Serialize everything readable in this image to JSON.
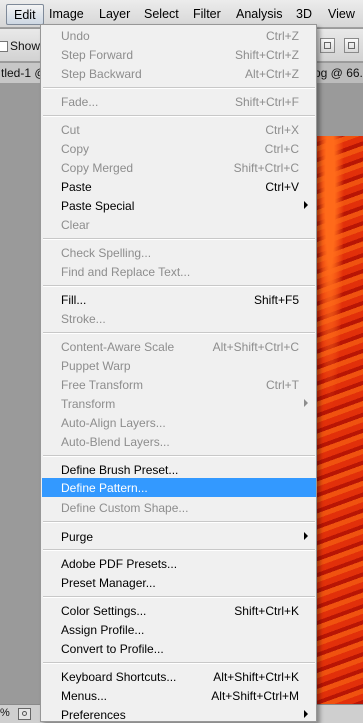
{
  "menubar": {
    "items": [
      "Edit",
      "Image",
      "Layer",
      "Select",
      "Filter",
      "Analysis",
      "3D",
      "View"
    ]
  },
  "options_bar": {
    "show_label": "Show E"
  },
  "tabs": {
    "left": "tled-1 @",
    "right": "pg @ 66."
  },
  "statusbar": {
    "zoom": "%"
  },
  "edit_menu": {
    "items": [
      {
        "label": "Undo",
        "shortcut": "Ctrl+Z",
        "enabled": false
      },
      {
        "label": "Step Forward",
        "shortcut": "Shift+Ctrl+Z",
        "enabled": false
      },
      {
        "label": "Step Backward",
        "shortcut": "Alt+Ctrl+Z",
        "enabled": false
      },
      {
        "label": "Fade...",
        "shortcut": "Shift+Ctrl+F",
        "enabled": false
      },
      {
        "label": "Cut",
        "shortcut": "Ctrl+X",
        "enabled": false
      },
      {
        "label": "Copy",
        "shortcut": "Ctrl+C",
        "enabled": false
      },
      {
        "label": "Copy Merged",
        "shortcut": "Shift+Ctrl+C",
        "enabled": false
      },
      {
        "label": "Paste",
        "shortcut": "Ctrl+V",
        "enabled": true
      },
      {
        "label": "Paste Special",
        "shortcut": "",
        "enabled": true,
        "submenu": true
      },
      {
        "label": "Clear",
        "shortcut": "",
        "enabled": false
      },
      {
        "label": "Check Spelling...",
        "shortcut": "",
        "enabled": false
      },
      {
        "label": "Find and Replace Text...",
        "shortcut": "",
        "enabled": false
      },
      {
        "label": "Fill...",
        "shortcut": "Shift+F5",
        "enabled": true
      },
      {
        "label": "Stroke...",
        "shortcut": "",
        "enabled": false
      },
      {
        "label": "Content-Aware Scale",
        "shortcut": "Alt+Shift+Ctrl+C",
        "enabled": false
      },
      {
        "label": "Puppet Warp",
        "shortcut": "",
        "enabled": false
      },
      {
        "label": "Free Transform",
        "shortcut": "Ctrl+T",
        "enabled": false
      },
      {
        "label": "Transform",
        "shortcut": "",
        "enabled": false,
        "submenu": true
      },
      {
        "label": "Auto-Align Layers...",
        "shortcut": "",
        "enabled": false
      },
      {
        "label": "Auto-Blend Layers...",
        "shortcut": "",
        "enabled": false
      },
      {
        "label": "Define Brush Preset...",
        "shortcut": "",
        "enabled": true
      },
      {
        "label": "Define Pattern...",
        "shortcut": "",
        "enabled": true,
        "highlighted": true
      },
      {
        "label": "Define Custom Shape...",
        "shortcut": "",
        "enabled": false
      },
      {
        "label": "Purge",
        "shortcut": "",
        "enabled": true,
        "submenu": true
      },
      {
        "label": "Adobe PDF Presets...",
        "shortcut": "",
        "enabled": true
      },
      {
        "label": "Preset Manager...",
        "shortcut": "",
        "enabled": true
      },
      {
        "label": "Color Settings...",
        "shortcut": "Shift+Ctrl+K",
        "enabled": true
      },
      {
        "label": "Assign Profile...",
        "shortcut": "",
        "enabled": true
      },
      {
        "label": "Convert to Profile...",
        "shortcut": "",
        "enabled": true
      },
      {
        "label": "Keyboard Shortcuts...",
        "shortcut": "Alt+Shift+Ctrl+K",
        "enabled": true
      },
      {
        "label": "Menus...",
        "shortcut": "Alt+Shift+Ctrl+M",
        "enabled": true
      },
      {
        "label": "Preferences",
        "shortcut": "",
        "enabled": true,
        "submenu": true
      }
    ]
  },
  "colors": {
    "highlight": "#3399ff",
    "disabled_text": "#8d8d8d",
    "menu_bg": "#f0f0f0"
  },
  "icons": {
    "checkbox": "checkbox-icon",
    "submenu": "submenu-arrow-icon",
    "status": "status-info-icon"
  }
}
